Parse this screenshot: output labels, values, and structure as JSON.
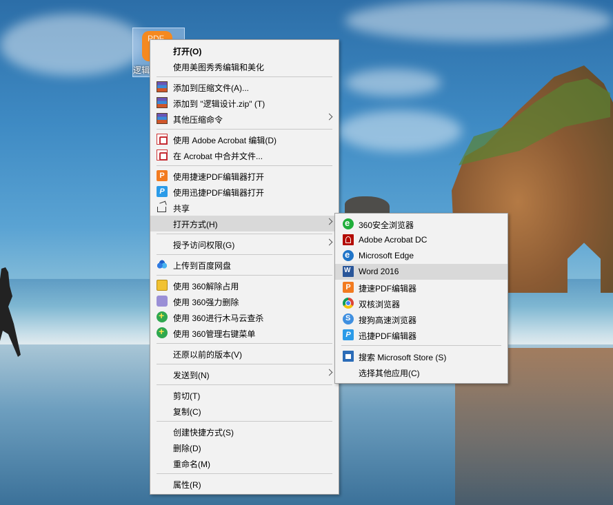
{
  "desktop": {
    "icon_label": "逻辑"
  },
  "context_menu": {
    "items": [
      {
        "label": "打开(O)",
        "icon": "none"
      },
      {
        "label": "使用美图秀秀编辑和美化",
        "icon": "none"
      },
      {
        "label": "添加到压缩文件(A)...",
        "icon": "winrar-icon"
      },
      {
        "label": "添加到 \"逻辑设计.zip\" (T)",
        "icon": "winrar-icon"
      },
      {
        "label": "其他压缩命令",
        "icon": "winrar-icon"
      },
      {
        "label": "使用 Adobe Acrobat 编辑(D)",
        "icon": "acrobat-edit-icon"
      },
      {
        "label": "在 Acrobat 中合并文件...",
        "icon": "acrobat-combine-icon"
      },
      {
        "label": "使用捷速PDF编辑器打开",
        "icon": "jiesu-pdf-icon"
      },
      {
        "label": "使用迅捷PDF编辑器打开",
        "icon": "xunjie-pdf-icon"
      },
      {
        "label": "共享",
        "icon": "share-icon"
      },
      {
        "label": "打开方式(H)",
        "icon": "none"
      },
      {
        "label": "授予访问权限(G)",
        "icon": "none"
      },
      {
        "label": "上传到百度网盘",
        "icon": "baidu-netdisk-icon"
      },
      {
        "label": "使用 360解除占用",
        "icon": "360-unlock-icon"
      },
      {
        "label": "使用 360强力删除",
        "icon": "360-delete-icon"
      },
      {
        "label": "使用 360进行木马云查杀",
        "icon": "360-scan-icon"
      },
      {
        "label": "使用 360管理右键菜单",
        "icon": "360-manage-icon"
      },
      {
        "label": "还原以前的版本(V)",
        "icon": "none"
      },
      {
        "label": "发送到(N)",
        "icon": "none"
      },
      {
        "label": "剪切(T)",
        "icon": "none"
      },
      {
        "label": "复制(C)",
        "icon": "none"
      },
      {
        "label": "创建快捷方式(S)",
        "icon": "none"
      },
      {
        "label": "删除(D)",
        "icon": "none"
      },
      {
        "label": "重命名(M)",
        "icon": "none"
      },
      {
        "label": "属性(R)",
        "icon": "none"
      }
    ]
  },
  "open_with_menu": {
    "items": [
      {
        "label": "360安全浏览器",
        "icon": "360-browser-icon"
      },
      {
        "label": "Adobe Acrobat DC",
        "icon": "acrobat-dc-icon"
      },
      {
        "label": "Microsoft Edge",
        "icon": "edge-icon"
      },
      {
        "label": "Word 2016",
        "icon": "word-icon"
      },
      {
        "label": "捷速PDF编辑器",
        "icon": "jiesu-pdf-icon"
      },
      {
        "label": "双核浏览器",
        "icon": "chrome-icon"
      },
      {
        "label": "搜狗高速浏览器",
        "icon": "sogou-icon"
      },
      {
        "label": "迅捷PDF编辑器",
        "icon": "xunjie-pdf-icon"
      },
      {
        "label": "搜索 Microsoft Store (S)",
        "icon": "store-icon"
      },
      {
        "label": "选择其他应用(C)",
        "icon": "none"
      }
    ]
  }
}
